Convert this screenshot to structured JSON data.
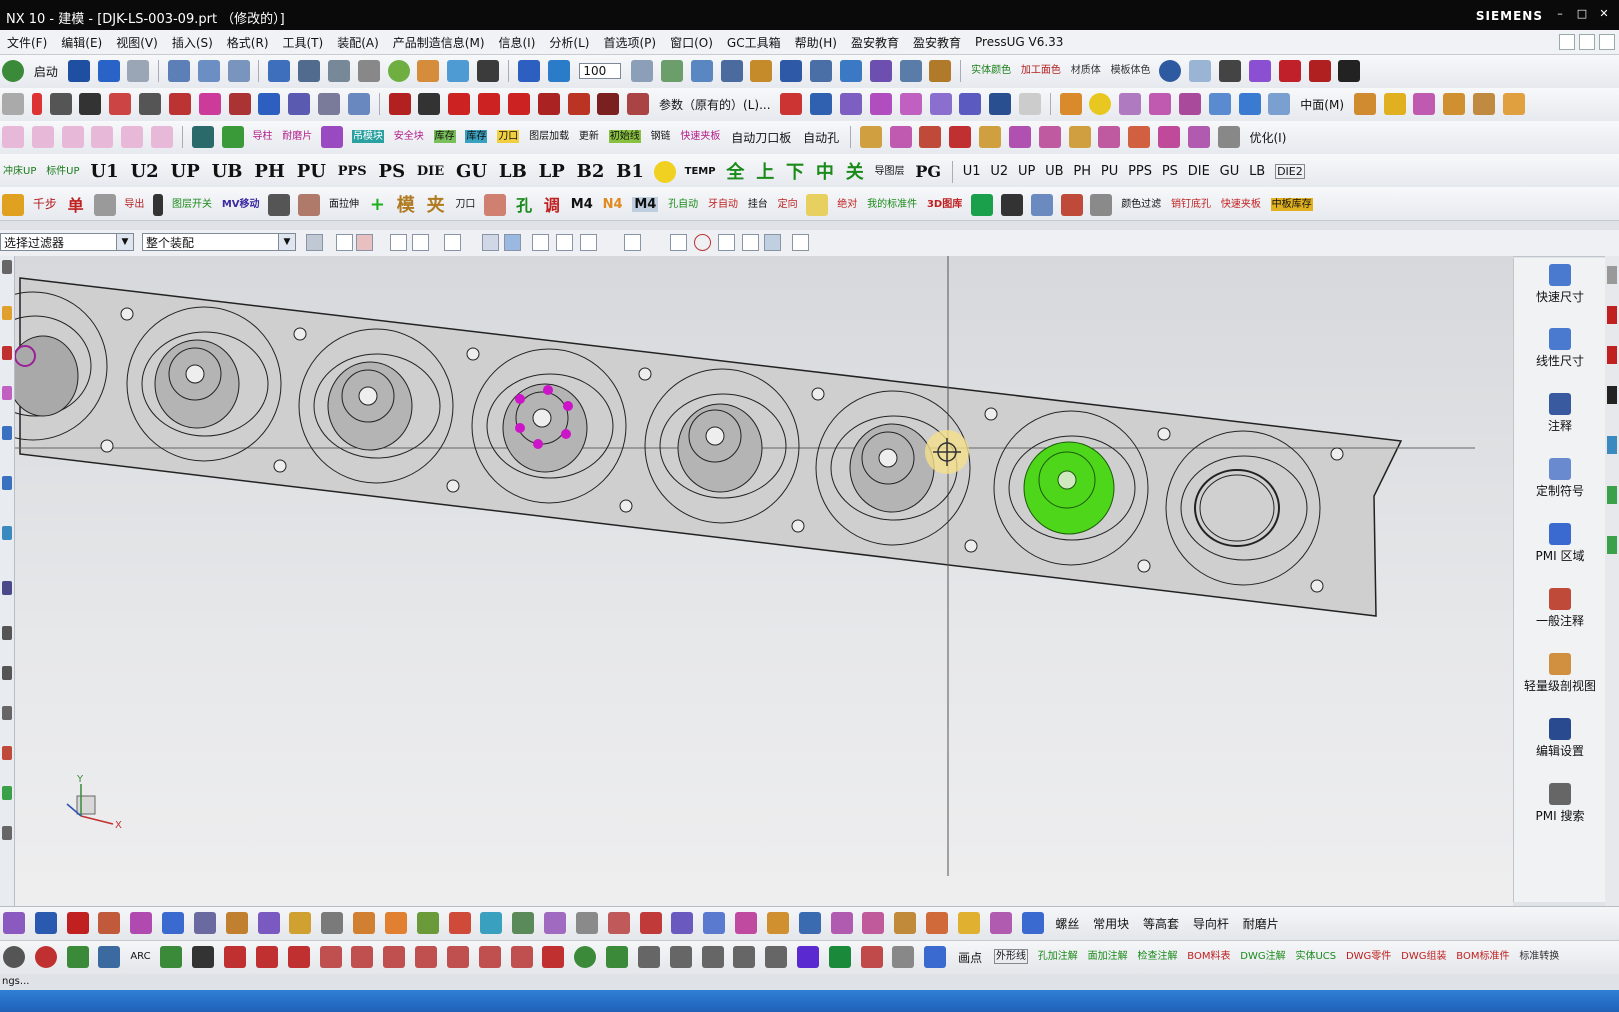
{
  "window": {
    "title": "NX 10 - 建模 - [DJK-LS-003-09.prt （修改的）]",
    "brand": "SIEMENS",
    "controls": [
      "–",
      "□",
      "✕"
    ]
  },
  "menu": [
    "文件(F)",
    "编辑(E)",
    "视图(V)",
    "插入(S)",
    "格式(R)",
    "工具(T)",
    "装配(A)",
    "产品制造信息(M)",
    "信息(I)",
    "分析(L)",
    "首选项(P)",
    "窗口(O)",
    "GC工具箱",
    "帮助(H)",
    "盈安教育",
    "盈安教育",
    "PressUG V6.33"
  ],
  "toolbar1": {
    "start_label": "启动",
    "zoom_value": "100",
    "right_labels": [
      "实体颜色",
      "加工面色",
      "材质体",
      "模板体色"
    ]
  },
  "toolbar2": {
    "param_label": "参数（原有的）(L)...",
    "mid_label": "中面(M)"
  },
  "toolbar3": {
    "labels_a": [
      "导柱",
      "耐磨片",
      "吊模块",
      "安全块",
      "库存",
      "库存",
      "刀口",
      "图层加载",
      "更新",
      "初始线",
      "钢链",
      "快速夹板"
    ],
    "labels_b": [
      "自动刀口板",
      "自动孔"
    ],
    "optimize_label": "优化(I)"
  },
  "toolbar4": {
    "small_a": [
      "冲床UP",
      "标件UP"
    ],
    "big": [
      "U1",
      "U2",
      "UP",
      "UB",
      "PH",
      "PU",
      "PPS",
      "PS",
      "DIE",
      "GU",
      "LB",
      "LP",
      "B2",
      "B1"
    ],
    "temp_label": "TEMP",
    "cn_big": [
      "全",
      "上",
      "下",
      "中",
      "关"
    ],
    "small_b": [
      "导图层"
    ],
    "pg_label": "PG",
    "moves": [
      "U1",
      "U2",
      "UP",
      "UB",
      "PH",
      "PU",
      "PPS",
      "PS",
      "DIE",
      "GU",
      "LB"
    ],
    "die2_label": "DIE2"
  },
  "toolbar5": {
    "items": [
      "千步",
      "单",
      "导出",
      "图层开关",
      "MV移动",
      "面拉伸",
      "模",
      "夹",
      "刀口",
      "孔",
      "调",
      "M4",
      "N4",
      "M4",
      "孔自动",
      "牙自动",
      "挂台",
      "定向",
      "绝对",
      "我的标准件",
      "3D图库",
      "颜色过滤",
      "销钉底孔",
      "快速夹板",
      "中板库存"
    ]
  },
  "filter": {
    "selection_filter": "选择过滤器",
    "scope": "整个装配"
  },
  "right_panel": [
    "快速尺寸",
    "线性尺寸",
    "注释",
    "定制符号",
    "PMI 区域",
    "一般注释",
    "轻量级剖视图",
    "编辑设置",
    "PMI 搜索"
  ],
  "bottom1": {
    "labels": [
      "螺丝",
      "常用块",
      "等高套",
      "导向杆",
      "耐磨片"
    ]
  },
  "bottom2": {
    "arc_label": "ARC",
    "point_label": "画点",
    "small": [
      "外形线",
      "孔加注解",
      "面加注解",
      "检查注解",
      "BOM料表",
      "DWG注解",
      "实体UCS",
      "DWG零件",
      "DWG组装",
      "BOM标准件",
      "标准转换"
    ]
  },
  "status_text": "ngs...",
  "colors": {
    "highlight_green": "#4ed61a",
    "pmi_magenta": "#cc14c8",
    "cursor_yellow": "#f5e08a",
    "viewport_bg": "#e2e3e5"
  }
}
